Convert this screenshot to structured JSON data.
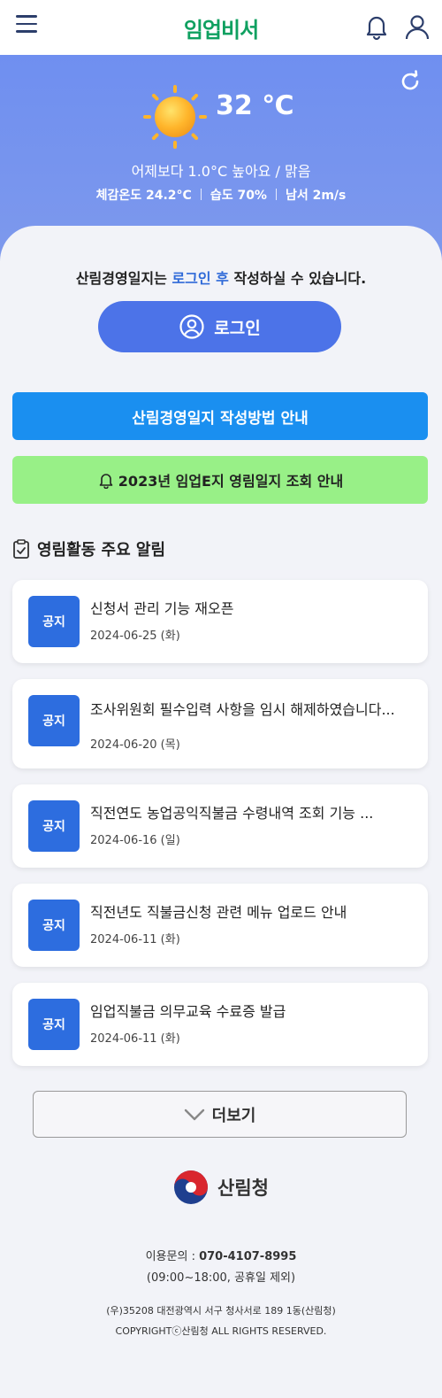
{
  "header": {
    "logo_text": "임업비서",
    "logo_color": "#0fa060",
    "menu_icon": "hamburger-menu-icon",
    "bell_icon": "bell-icon",
    "user_icon": "user-icon"
  },
  "weather": {
    "icon": "sun-icon",
    "temperature": "32 ℃",
    "comparison": "어제보다 1.0°C 높아요 / 맑음",
    "feels_like": "체감온도 24.2°C",
    "humidity": "습도 70%",
    "wind": "남서 2m/s",
    "refresh_icon": "refresh-icon",
    "bg_color": "#7391ee"
  },
  "login": {
    "note_prefix": "산림경영일지는 ",
    "note_highlight": "로그인 후",
    "note_suffix": " 작성하실 수 있습니다.",
    "button_label": "로그인",
    "button_color": "#4c73e8"
  },
  "banners": {
    "guide_label": "산림경영일지 작성방법 안내",
    "guide_color": "#1a8ff0",
    "notice_label": "2023년 임업E지 영림일지 조회 안내",
    "notice_color": "#98f087"
  },
  "section": {
    "title": "영림활동 주요 알림",
    "icon": "clipboard-check-icon"
  },
  "notices": [
    {
      "badge": "공지",
      "title": "신청서 관리 기능 재오픈",
      "date": "2024-06-25 (화)"
    },
    {
      "badge": "공지",
      "title": "조사위원회 필수입력 사항을 임시 해제하였습니다...",
      "date": "2024-06-20 (목)"
    },
    {
      "badge": "공지",
      "title": "직전연도 농업공익직불금 수령내역 조회 기능 ...",
      "date": "2024-06-16 (일)"
    },
    {
      "badge": "공지",
      "title": "직전년도 직불금신청 관련 메뉴 업로드 안내",
      "date": "2024-06-11 (화)"
    },
    {
      "badge": "공지",
      "title": "임업직불금 의무교육 수료증 발급",
      "date": "2024-06-11 (화)"
    }
  ],
  "more": {
    "label": "더보기",
    "icon": "chevron-down-icon"
  },
  "footer": {
    "org_name": "산림청",
    "contact_label": "이용문의 : ",
    "contact_phone": "070-4107-8995",
    "hours": "(09:00~18:00, 공휴일 제외)",
    "address": "(우)35208 대전광역시 서구 청사서로 189 1동(산림청)",
    "copyright": "COPYRIGHTⓒ산림청 ALL RIGHTS RESERVED."
  }
}
